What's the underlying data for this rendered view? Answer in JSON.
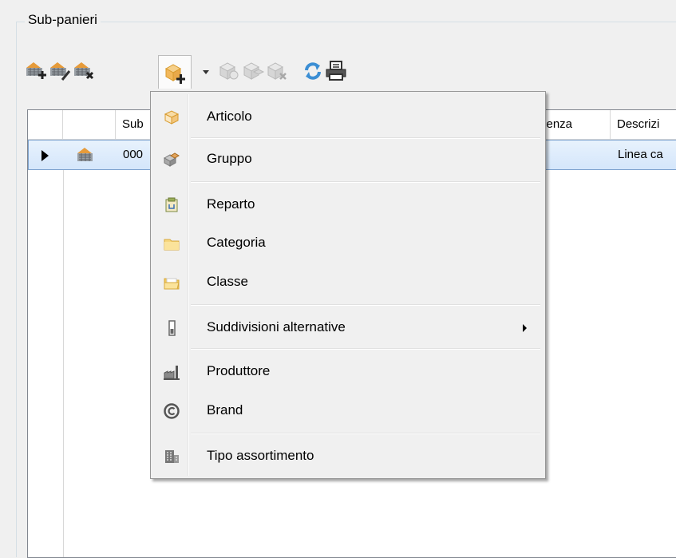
{
  "group": {
    "title": "Sub-panieri"
  },
  "toolbar": {
    "buttons": [
      {
        "icon": "basket-add-icon",
        "enabled": true
      },
      {
        "icon": "basket-edit-icon",
        "enabled": true
      },
      {
        "icon": "basket-delete-icon",
        "enabled": true
      },
      {
        "icon": "box-add-dropdown-icon",
        "enabled": true,
        "pressed": true
      },
      {
        "icon": "box-outline-icon",
        "enabled": false
      },
      {
        "icon": "box-group-icon",
        "enabled": false
      },
      {
        "icon": "box-delete-icon",
        "enabled": false
      },
      {
        "icon": "refresh-icon",
        "enabled": true
      },
      {
        "icon": "printer-icon",
        "enabled": true
      }
    ]
  },
  "grid": {
    "columns": [
      "",
      "",
      "Sub",
      "",
      "senza",
      "Descrizi"
    ],
    "rows": [
      {
        "selected": true,
        "icon": "basket-icon",
        "code": "000",
        "descrizione": "Linea ca"
      }
    ]
  },
  "menu": {
    "items": [
      {
        "label": "Articolo",
        "icon": "article-box-icon"
      },
      {
        "label": "Gruppo",
        "icon": "group-box-icon"
      },
      {
        "label": "Reparto",
        "icon": "department-icon"
      },
      {
        "label": "Categoria",
        "icon": "folder-icon"
      },
      {
        "label": "Classe",
        "icon": "folder-open-icon"
      },
      {
        "label": "Suddivisioni alternative",
        "icon": "battery-icon",
        "submenu": true
      },
      {
        "label": "Produttore",
        "icon": "factory-icon"
      },
      {
        "label": "Brand",
        "icon": "copyright-icon"
      },
      {
        "label": "Tipo assortimento",
        "icon": "building-icon"
      }
    ]
  },
  "colors": {
    "accent": "#7da2ce",
    "selection": "#d4e6fb",
    "menu_bg": "#f0f0f0",
    "orange": "#e8a33d",
    "blue": "#3b8ed4"
  }
}
